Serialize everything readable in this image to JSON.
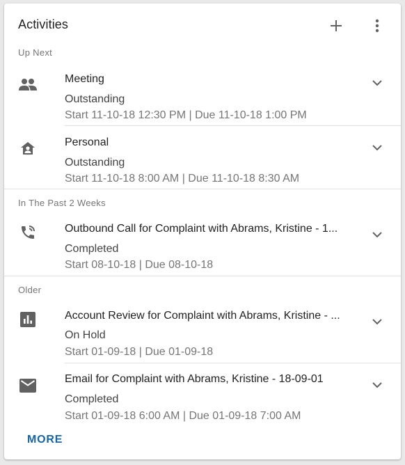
{
  "header": {
    "title": "Activities"
  },
  "sections": {
    "up_next": "Up Next",
    "past_two_weeks": "In The Past 2 Weeks",
    "older": "Older"
  },
  "items": [
    {
      "icon": "people-icon",
      "title": "Meeting",
      "status": "Outstanding",
      "dates": "Start 11-10-18 12:30 PM | Due 11-10-18 1:00 PM"
    },
    {
      "icon": "personal-home-icon",
      "title": "Personal",
      "status": "Outstanding",
      "dates": "Start 11-10-18 8:00 AM | Due 11-10-18 8:30 AM"
    },
    {
      "icon": "phone-call-icon",
      "title": "Outbound Call for Complaint with Abrams, Kristine - 1...",
      "status": "Completed",
      "dates": "Start 08-10-18 | Due 08-10-18"
    },
    {
      "icon": "bar-chart-icon",
      "title": "Account Review for Complaint with Abrams, Kristine - ...",
      "status": "On Hold",
      "dates": "Start 01-09-18 | Due 01-09-18"
    },
    {
      "icon": "email-icon",
      "title": "Email for Complaint with Abrams, Kristine - 18-09-01",
      "status": "Completed",
      "dates": "Start 01-09-18 6:00 AM | Due 01-09-18 7:00 AM"
    }
  ],
  "footer": {
    "more_label": "MORE"
  },
  "colors": {
    "icon": "#616161",
    "link": "#1565a8",
    "divider": "#e0e0e0"
  }
}
